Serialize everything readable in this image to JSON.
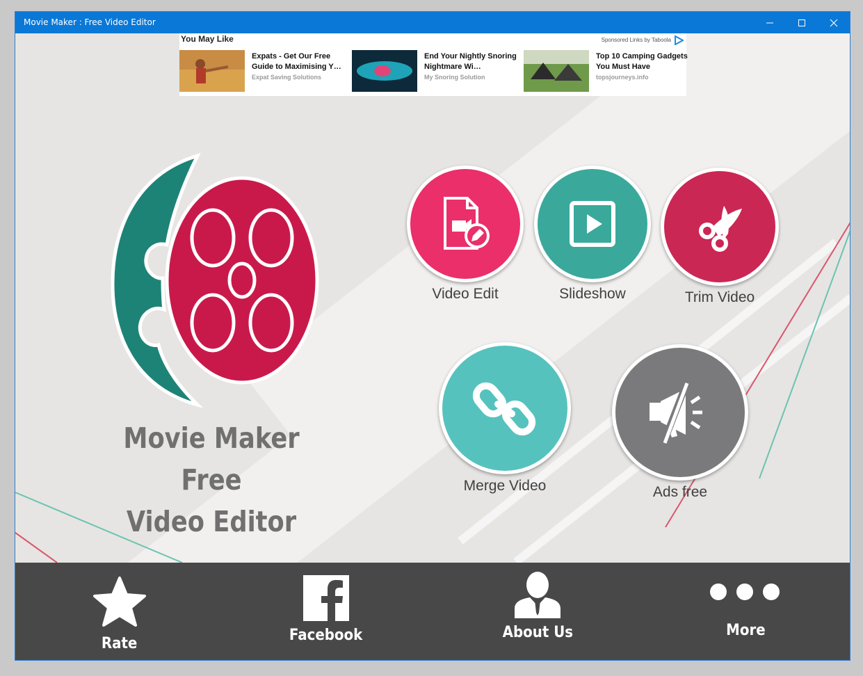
{
  "window": {
    "title": "Movie Maker : Free Video Editor"
  },
  "ad": {
    "heading": "You May Like",
    "sponsor": "Sponsored Links by Taboola",
    "items": [
      {
        "title": "Expats - Get Our Free Guide to Maximising Y…",
        "source": "Expat Saving Solutions"
      },
      {
        "title": "End Your Nightly Snoring Nightmare Wi…",
        "source": "My Snoring Solution"
      },
      {
        "title": "Top 10 Camping Gadgets You Must Have",
        "source": "topsjourneys.info"
      }
    ]
  },
  "app": {
    "title_line1": "Movie Maker Free",
    "title_line2": "Video Editor"
  },
  "features": [
    {
      "label": "Video Edit",
      "color": "#ea2f6b",
      "icon": "video-file-edit-icon"
    },
    {
      "label": "Slideshow",
      "color": "#3aa99b",
      "icon": "play-square-icon"
    },
    {
      "label": "Trim Video",
      "color": "#cb2754",
      "icon": "scissors-icon"
    },
    {
      "label": "Merge Video",
      "color": "#56c2be",
      "icon": "chain-link-icon"
    },
    {
      "label": "Ads free",
      "color": "#7a7a7c",
      "icon": "mute-megaphone-icon"
    }
  ],
  "bottom_nav": [
    {
      "label": "Rate",
      "icon": "star-icon"
    },
    {
      "label": "Facebook",
      "icon": "facebook-icon"
    },
    {
      "label": "About Us",
      "icon": "person-icon"
    },
    {
      "label": "More",
      "icon": "more-dots-icon"
    }
  ]
}
